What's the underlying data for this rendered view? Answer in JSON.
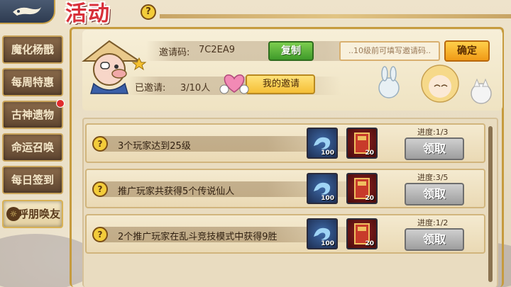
{
  "header": {
    "title": "活动",
    "help_glyph": "?"
  },
  "sidebar": {
    "items": [
      {
        "label": "魔化杨戬",
        "active": false,
        "badge": false
      },
      {
        "label": "每周特惠",
        "active": false,
        "badge": false
      },
      {
        "label": "古神遗物",
        "active": false,
        "badge": true
      },
      {
        "label": "命运召唤",
        "active": false,
        "badge": false
      },
      {
        "label": "每日签到",
        "active": false,
        "badge": false
      },
      {
        "label": "呼朋唤友",
        "active": true,
        "badge": false
      }
    ]
  },
  "invite": {
    "code_label": "邀请码:",
    "code_value": "7C2EA9",
    "copy_label": "复制",
    "input_placeholder": "..10级前可填写邀请码..",
    "confirm_label": "确定",
    "invited_label": "已邀请:",
    "invited_value": "3/10人",
    "my_invite_label": "我的邀请"
  },
  "tasks": [
    {
      "text": "3个玩家达到25级",
      "progress": "进度:1/3",
      "claim_label": "领取",
      "rewards": [
        {
          "type": "gem-icon",
          "qty": "100"
        },
        {
          "type": "card-icon",
          "qty": "20"
        }
      ]
    },
    {
      "text": "推广玩家共获得5个传说仙人",
      "progress": "进度:3/5",
      "claim_label": "领取",
      "rewards": [
        {
          "type": "gem-icon",
          "qty": "100"
        },
        {
          "type": "card-icon",
          "qty": "20"
        }
      ]
    },
    {
      "text": "2个推广玩家在乱斗竞技模式中获得9胜",
      "progress": "进度:1/2",
      "claim_label": "领取",
      "rewards": [
        {
          "type": "gem-icon",
          "qty": "100"
        },
        {
          "type": "card-icon",
          "qty": "20"
        }
      ]
    }
  ],
  "colors": {
    "accent_gold": "#c69b3e",
    "copy_green": "#3f9a2a",
    "confirm_orange": "#f09a16",
    "claim_gray": "#9e9e9e",
    "badge_red": "#e02c2c"
  }
}
